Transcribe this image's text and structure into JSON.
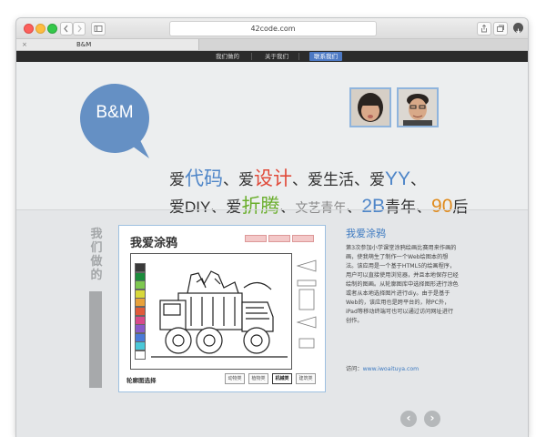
{
  "browser": {
    "address": "42code.com",
    "tab_title": "B&M",
    "tab_close": "×"
  },
  "nav": {
    "items": [
      {
        "label": "我们做的",
        "active": false
      },
      {
        "label": "关于我们",
        "active": false
      },
      {
        "label": "联系我们",
        "active": true
      }
    ]
  },
  "hero": {
    "logo": "B&M",
    "slogan_line1": [
      {
        "t": "爱",
        "c": ""
      },
      {
        "t": "代码",
        "c": "blue"
      },
      {
        "t": "、爱",
        "c": ""
      },
      {
        "t": "设计",
        "c": "red"
      },
      {
        "t": "、爱生活",
        "c": ""
      },
      {
        "t": "、爱",
        "c": ""
      },
      {
        "t": "YY",
        "c": "blue"
      },
      {
        "t": "、",
        "c": ""
      }
    ],
    "slogan_line2": [
      {
        "t": "爱DIY",
        "c": ""
      },
      {
        "t": "、爱",
        "c": ""
      },
      {
        "t": "折腾",
        "c": "green"
      },
      {
        "t": "、",
        "c": ""
      },
      {
        "t": "文艺青年",
        "c": "grey"
      },
      {
        "t": "、",
        "c": ""
      },
      {
        "t": "2B",
        "c": "blue"
      },
      {
        "t": "青年",
        "c": ""
      },
      {
        "t": "、",
        "c": ""
      },
      {
        "t": "90",
        "c": "orange"
      },
      {
        "t": "后",
        "c": ""
      }
    ]
  },
  "works": {
    "section_label": "我们做的",
    "app_title": "我爱涂鸦",
    "app_footer_label": "轮廓图选择",
    "app_footer_buttons": [
      "动物类",
      "植物类",
      "机械类",
      "建筑类"
    ],
    "app_active_button": "机械类",
    "title": "我爱涂鸦",
    "description": "第3次参加小学课堂涂鸦绘画比赛用来作画的画，使我萌生了制作一个Web绘图本的想法。该应用是一个基于HTML5的绘画程序，用户可以直接使用浏览器，并且本地保存已经绘制的图画。从轮廓图库中选择图形进行涂色或者从本地选择图片进行diy。由于是基于Web的，该应用也是跨平台的，除PC外，iPad等移动终端可也可以通过访问网址进行创作。",
    "visit_label": "访问：",
    "visit_link": "www.iwoaituya.com"
  },
  "pager": {
    "prev": "‹",
    "next": "›"
  },
  "colors": {
    "accent": "#4d79c4",
    "logo": "#6590c4",
    "nav_bg": "#2b2b2b",
    "palette": [
      "#3a3a3a",
      "#1b8c3c",
      "#7ec850",
      "#d8d83a",
      "#e8a13a",
      "#e05a3a",
      "#d84a8a",
      "#8a5ac8",
      "#4a7ad8",
      "#4ac8d8",
      "#ffffff"
    ]
  }
}
